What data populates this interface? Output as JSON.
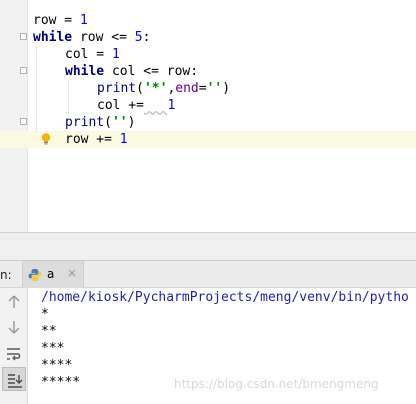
{
  "editor": {
    "lines": {
      "l1": {
        "a": "row = ",
        "b": "1"
      },
      "l2": {
        "a": "while",
        "b": " row <= ",
        "c": "5",
        "d": ":"
      },
      "l3": {
        "a": "col = ",
        "b": "1"
      },
      "l4": {
        "a": "while",
        "b": " col <= row:"
      },
      "l5": {
        "a": "print",
        "b": "(",
        "c": "'*'",
        "d": ",",
        "e": "end",
        "f": "=",
        "g": "''",
        "h": ")"
      },
      "l6": {
        "a": "col +=",
        "b": "   ",
        "c": "1"
      },
      "l7": {
        "a": "print",
        "b": "(",
        "c": "''",
        "d": ")"
      },
      "l8": {
        "a": "row += ",
        "b": "1"
      }
    },
    "icons": {
      "fold": "fold-marker-icon",
      "bulb": "lightbulb-icon"
    }
  },
  "run": {
    "label": "n:",
    "tab_name": "a",
    "tab_close": "×",
    "icons": [
      "up-arrow-icon",
      "down-arrow-icon",
      "soft-wrap-icon",
      "scroll-to-end-icon"
    ]
  },
  "console": {
    "path": "/home/kiosk/PycharmProjects/meng/venv/bin/pytho",
    "output": [
      "*",
      "**",
      "***",
      "****",
      "*****"
    ]
  },
  "watermark": "https://blog.csdn.net/bmengmeng",
  "colors": {
    "keyword": "#000080",
    "number": "#0000ff",
    "string": "#008000",
    "keyword_arg": "#660099",
    "current_line": "#fcfae1",
    "console_path": "#1f1fa8"
  }
}
